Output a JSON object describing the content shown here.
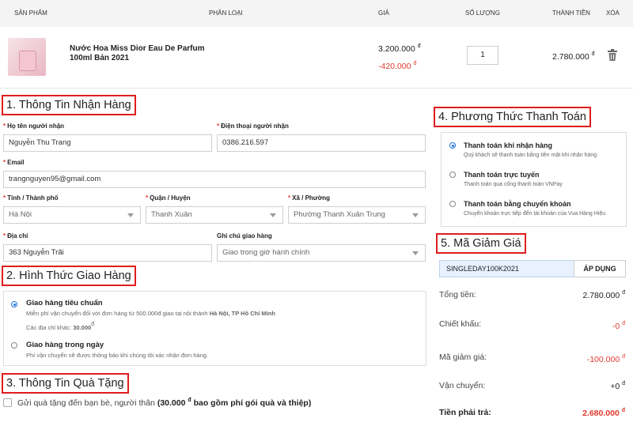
{
  "cart": {
    "headers": [
      "SẢN PHẨM",
      "PHÂN LOẠI",
      "GIÁ",
      "SỐ LƯỢNG",
      "THÀNH TIỀN",
      "XÓA"
    ],
    "item": {
      "name": "Nước Hoa Miss Dior Eau De Parfum 100ml Bản 2021",
      "price": "3.200.000",
      "discount": "-420.000",
      "quantity": "1",
      "subtotal": "2.780.000"
    },
    "currency": "đ"
  },
  "recipient": {
    "title": "1. Thông Tin Nhận Hàng",
    "name_label": "Họ tên người nhận",
    "name_value": "Nguyễn Thu Trang",
    "phone_label": "Điện thoại người nhận",
    "phone_value": "0386.216.597",
    "email_label": "Email",
    "email_value": "trangnguyen95@gmail.com",
    "city_label": "Tỉnh / Thành phố",
    "city_value": "Hà Nội",
    "district_label": "Quận / Huyện",
    "district_value": "Thanh Xuân",
    "ward_label": "Xã / Phường",
    "ward_value": "Phường Thanh Xuân Trung",
    "address_label": "Địa chỉ",
    "address_value": "363 Nguyễn Trãi",
    "note_label": "Ghi chú giao hàng",
    "note_value": "Giao trong giờ hành chính"
  },
  "shipping": {
    "title": "2. Hình Thức Giao Hàng",
    "standard_title": "Giao hàng tiêu chuẩn",
    "standard_desc_a": "Miễn phí vận chuyển đối với đơn hàng từ 500.000đ giao tại nội thành",
    "standard_desc_b": "Hà Nội, TP Hồ Chí Minh",
    "standard_desc_c": "Các địa chỉ khác:",
    "standard_desc_d": "30.000",
    "sameday_title": "Giao hàng trong ngày",
    "sameday_desc": "Phí vận chuyển sẽ được thông báo khi chúng tôi xác nhận đơn hàng."
  },
  "gift": {
    "title": "3. Thông Tin Quà Tặng",
    "label_a": "Gửi quà tặng đến bạn bè, người thân",
    "label_b": "(30.000",
    "label_c": "bao gồm phí gói quà và thiệp)"
  },
  "payment": {
    "title": "4. Phương Thức Thanh Toán",
    "options": [
      {
        "title": "Thanh toán khi nhận hàng",
        "desc": "Quý khách sẽ thanh toán bằng tiền mặt khi nhận hàng"
      },
      {
        "title": "Thanh toán trực tuyến",
        "desc": "Thanh toán qua cổng thanh toán VNPay"
      },
      {
        "title": "Thanh toán bằng chuyển khoản",
        "desc": "Chuyển khoản trực tiếp đến tài khoản của Vua Hàng Hiệu"
      }
    ]
  },
  "coupon": {
    "title": "5. Mã Giảm Giá",
    "code": "SINGLEDAY100K2021",
    "apply_label": "ÁP DỤNG"
  },
  "summary": {
    "total_label": "Tổng tiền:",
    "total_value": "2.780.000",
    "discount_label": "Chiết khấu:",
    "discount_value": "-0",
    "coupon_label": "Mã giảm giá:",
    "coupon_value": "-100.000",
    "shipping_label": "Vận chuyển:",
    "shipping_value": "+0",
    "pay_label": "Tiền phải trả:",
    "pay_value": "2.680.000"
  },
  "colors": {
    "accent_red": "#e03a2f",
    "section_border": "#e01c1c",
    "radio_blue": "#1e6fd9"
  }
}
